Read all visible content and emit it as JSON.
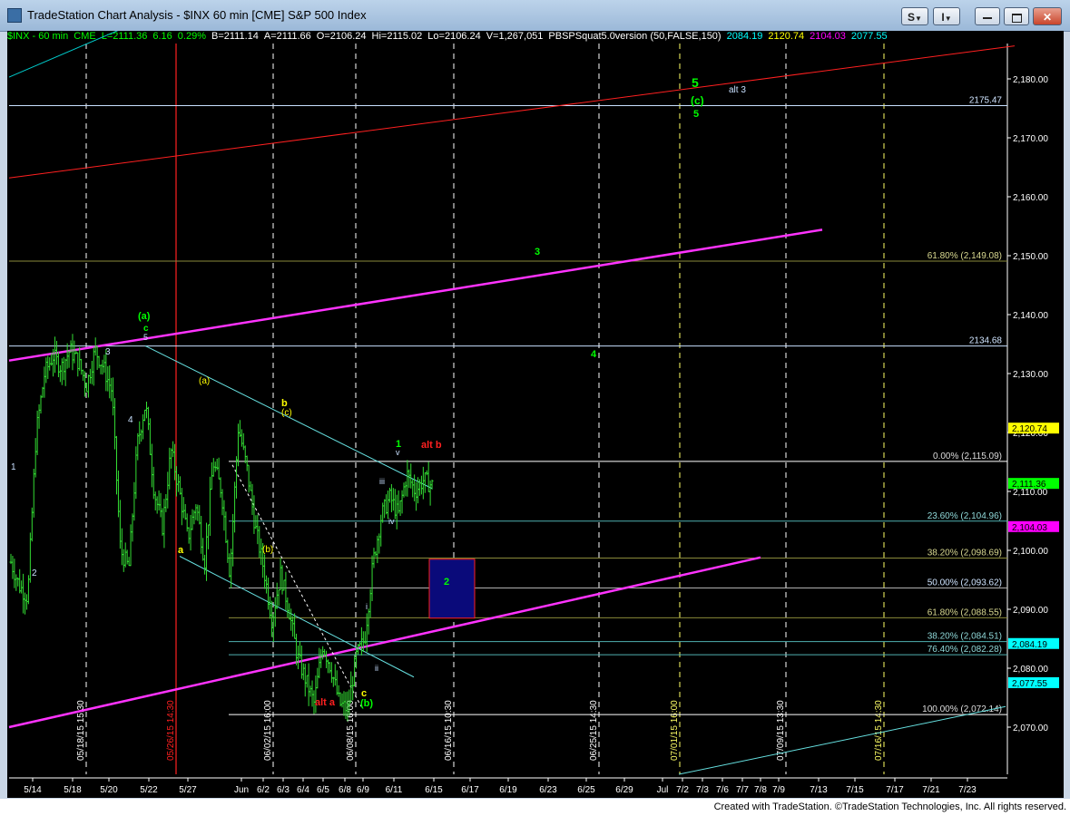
{
  "window": {
    "title": "TradeStation Chart Analysis - $INX 60 min [CME] S&P 500 Index",
    "buttons": {
      "s": "S",
      "i": "I",
      "minimize": "▭",
      "restore": "▭",
      "close": "✕"
    }
  },
  "status_bar": [
    {
      "text": "$INX - 60 min",
      "color": "#00ff00"
    },
    {
      "text": "CME",
      "color": "#00ff00"
    },
    {
      "text": "L=2111.36",
      "color": "#00ff00"
    },
    {
      "text": "6.16",
      "color": "#00ff00"
    },
    {
      "text": "0.29%",
      "color": "#00ff00"
    },
    {
      "text": "B=2111.14",
      "color": "#ffffff"
    },
    {
      "text": "A=2111.66",
      "color": "#ffffff"
    },
    {
      "text": "O=2106.24",
      "color": "#ffffff"
    },
    {
      "text": "Hi=2115.02",
      "color": "#ffffff"
    },
    {
      "text": "Lo=2106.24",
      "color": "#ffffff"
    },
    {
      "text": "V=1,267,051",
      "color": "#ffffff"
    },
    {
      "text": "PBSPSquat5.0version (50,FALSE,150)",
      "color": "#ffffff"
    },
    {
      "text": "2084.19",
      "color": "#00ffff"
    },
    {
      "text": "2120.74",
      "color": "#ffff00"
    },
    {
      "text": "2104.03",
      "color": "#ff00ff"
    },
    {
      "text": "2077.55",
      "color": "#00ffff"
    }
  ],
  "chart_data": {
    "type": "ohlc_bars",
    "symbol": "$INX",
    "interval": "60 min",
    "ylim": [
      2062,
      2186
    ],
    "y_ticks": [
      2070,
      2080,
      2090,
      2100,
      2110,
      2120,
      2130,
      2140,
      2150,
      2160,
      2170,
      2180
    ],
    "y_tick_labels": [
      "2,070.00",
      "2,080.00",
      "2,090.00",
      "2,100.00",
      "2,110.00",
      "2,120.00",
      "2,130.00",
      "2,140.00",
      "2,150.00",
      "2,160.00",
      "2,170.00",
      "2,180.00"
    ],
    "x_tick_labels": [
      "5/14",
      "5/18",
      "5/20",
      "5/22",
      "5/27",
      "Jun",
      "6/2",
      "6/3",
      "6/4",
      "6/5",
      "6/8",
      "6/9",
      "6/11",
      "6/15",
      "6/17",
      "6/19",
      "6/23",
      "6/25",
      "6/29",
      "Jul",
      "7/2",
      "7/3",
      "7/6",
      "7/7",
      "7/8",
      "7/9",
      "7/13",
      "7/15",
      "7/17",
      "7/21",
      "7/23"
    ],
    "last_price_markers": [
      {
        "label": "2,120.74",
        "value": 2120.74,
        "bg": "#ffff00",
        "fg": "#000000"
      },
      {
        "label": "2,111.36",
        "value": 2111.36,
        "bg": "#00ff00",
        "fg": "#000000"
      },
      {
        "label": "2,104.03",
        "value": 2104.03,
        "bg": "#ff00ff",
        "fg": "#000000"
      },
      {
        "label": "2,084.19",
        "value": 2084.19,
        "bg": "#00ffff",
        "fg": "#000000"
      },
      {
        "label": "2,077.55",
        "value": 2077.55,
        "bg": "#00ffff",
        "fg": "#000000"
      }
    ],
    "horizontal_levels": [
      {
        "label": "2175.47",
        "value": 2175.47,
        "color": "#c8e0ff"
      },
      {
        "label": "2134.68",
        "value": 2134.68,
        "color": "#c8e0ff"
      },
      {
        "label": "61.80% (2,149.08)",
        "value": 2149.08,
        "color": "#8a8a3a"
      },
      {
        "label": "0.00% (2,115.09)",
        "value": 2115.09,
        "color": "#ffffff"
      },
      {
        "label": "23.60% (2,104.96)",
        "value": 2104.96,
        "color": "#4fb0b0"
      },
      {
        "label": "38.20% (2,098.69)",
        "value": 2098.69,
        "color": "#8a8a3a"
      },
      {
        "label": "50.00% (2,093.62)",
        "value": 2093.62,
        "color": "#b0b0b0"
      },
      {
        "label": "61.80% (2,088.55)",
        "value": 2088.55,
        "color": "#8a8a3a"
      },
      {
        "label": "38.20% (2,084.51)",
        "value": 2084.51,
        "color": "#4fb0b0"
      },
      {
        "label": "76.40% (2,082.28)",
        "value": 2082.28,
        "color": "#4fb0b0"
      },
      {
        "label": "100.00% (2,072.14)",
        "value": 2072.14,
        "color": "#ffffff"
      }
    ],
    "vertical_session_labels": [
      "05/18/15 15:30",
      "05/26/15 14:30",
      "06/02/15 16:00",
      "06/08/15 16:00",
      "06/16/15 10:30",
      "06/25/15 14:30",
      "07/01/15 16:00",
      "07/09/15 13:30",
      "07/16/15 14:30"
    ],
    "wave_labels": [
      {
        "text": "5",
        "color": "#00ff00"
      },
      {
        "text": "(c)",
        "color": "#00ff00"
      },
      {
        "text": "5",
        "color": "#00ff00"
      },
      {
        "text": "alt 3",
        "color": "#c8e0ff"
      },
      {
        "text": "3",
        "color": "#00ff00"
      },
      {
        "text": "4",
        "color": "#00ff00"
      },
      {
        "text": "2",
        "color": "#00ff00"
      },
      {
        "text": "(a)",
        "color": "#00ff00"
      },
      {
        "text": "c",
        "color": "#00ff00"
      },
      {
        "text": "5",
        "color": "#c8e0ff"
      },
      {
        "text": "3",
        "color": "#c8e0ff"
      },
      {
        "text": "4",
        "color": "#c8e0ff"
      },
      {
        "text": "1",
        "color": "#c8e0ff"
      },
      {
        "text": "2",
        "color": "#c8e0ff"
      },
      {
        "text": "a",
        "color": "#ffff00"
      },
      {
        "text": "(a)",
        "color": "#ffff00"
      },
      {
        "text": "(b)",
        "color": "#ffff00"
      },
      {
        "text": "b",
        "color": "#ffff00"
      },
      {
        "text": "(c)",
        "color": "#ffff00"
      },
      {
        "text": "c",
        "color": "#ffff00"
      },
      {
        "text": "(b)",
        "color": "#00ff00"
      },
      {
        "text": "alt a",
        "color": "#ff2020"
      },
      {
        "text": "1",
        "color": "#00ff00"
      },
      {
        "text": "v",
        "color": "#c8e0ff"
      },
      {
        "text": "alt b",
        "color": "#ff2020"
      },
      {
        "text": "iii",
        "color": "#c8e0ff"
      },
      {
        "text": "iv",
        "color": "#c8e0ff"
      },
      {
        "text": "i",
        "color": "#c8e0ff"
      },
      {
        "text": "ii",
        "color": "#c8e0ff"
      }
    ],
    "target_box": {
      "from": 2098.5,
      "to": 2088.5,
      "fill": "#0a0a7a",
      "stroke": "#ff2020"
    },
    "price_path_anchors": [
      2098,
      2094,
      2092,
      2120,
      2130,
      2133,
      2131,
      2134,
      2132,
      2128,
      2134,
      2131,
      2127,
      2100,
      2097,
      2118,
      2125,
      2110,
      2104,
      2117,
      2110,
      2102,
      2108,
      2098,
      2115,
      2110,
      2096,
      2121,
      2114,
      2104,
      2097,
      2088,
      2096,
      2090,
      2082,
      2078,
      2074,
      2084,
      2080,
      2074,
      2073,
      2082,
      2085,
      2098,
      2106,
      2109,
      2106,
      2113,
      2110,
      2112,
      2111
    ]
  },
  "credit": "Created with TradeStation. ©TradeStation Technologies, Inc. All rights reserved."
}
